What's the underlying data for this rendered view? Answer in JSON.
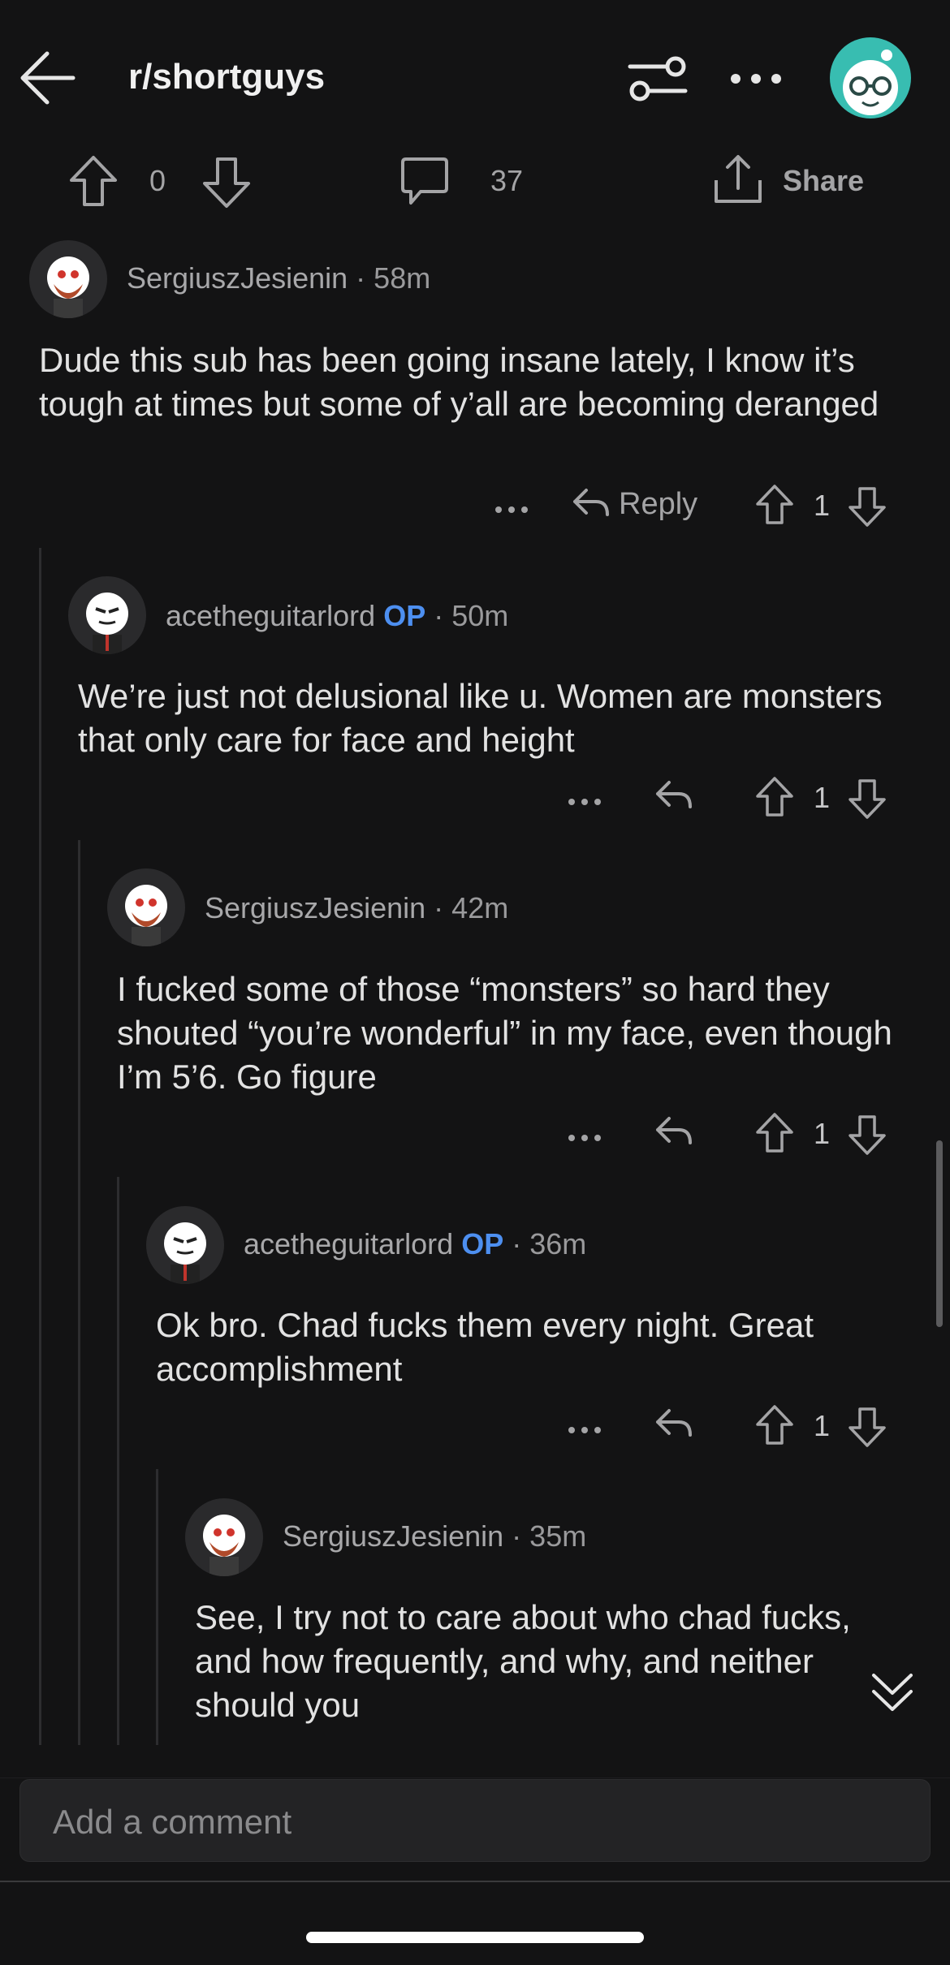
{
  "header": {
    "subreddit": "r/shortguys",
    "back_icon": "arrow-left-icon",
    "filter_icon": "sliders-icon",
    "more_icon": "ellipsis-icon"
  },
  "post_actions": {
    "score": "0",
    "comment_count": "37",
    "share_label": "Share"
  },
  "comments": [
    {
      "user": "SergiuszJesienin",
      "op": "",
      "time": "58m",
      "body": "Dude this sub has been going insane lately, I know it’s tough at times but some of y’all are becoming deranged",
      "reply_label": "Reply",
      "votes": "1"
    },
    {
      "user": "acetheguitarlord",
      "op": "OP",
      "time": "50m",
      "body": "We’re just not delusional like u. Women are monsters that only care for face and height",
      "reply_label": "",
      "votes": "1"
    },
    {
      "user": "SergiuszJesienin",
      "op": "",
      "time": "42m",
      "body": "I fucked some of those “monsters” so hard they shouted “you’re wonderful” in my face, even though I’m 5’6. Go figure",
      "reply_label": "",
      "votes": "1"
    },
    {
      "user": "acetheguitarlord",
      "op": "OP",
      "time": "36m",
      "body": "Ok bro. Chad fucks them every night. Great accomplishment",
      "reply_label": "",
      "votes": "1"
    },
    {
      "user": "SergiuszJesienin",
      "op": "",
      "time": "35m",
      "body": "See, I try not to care about who chad fucks, and how frequently, and why, and neither should you",
      "reply_label": "",
      "votes": ""
    }
  ],
  "composer": {
    "placeholder": "Add a comment"
  },
  "colors": {
    "background": "#131314",
    "op_badge": "#4d8ff0",
    "avatar_teal": "#38bdb1"
  }
}
